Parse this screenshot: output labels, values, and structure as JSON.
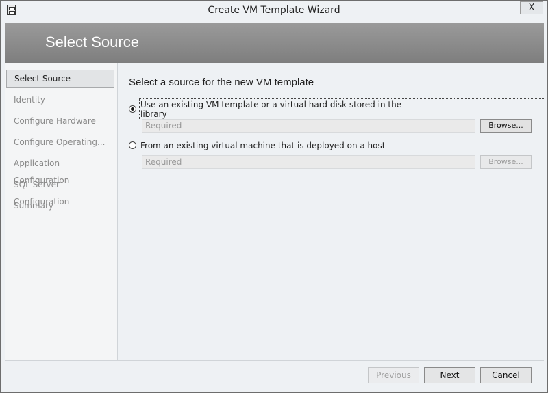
{
  "window": {
    "title": "Create VM Template Wizard",
    "close_glyph": "X",
    "app_icon": "server-icon"
  },
  "banner": {
    "title": "Select Source"
  },
  "nav": {
    "items": [
      {
        "label": "Select Source",
        "selected": true
      },
      {
        "label": "Identity",
        "selected": false
      },
      {
        "label": "Configure Hardware",
        "selected": false
      },
      {
        "label": "Configure Operating...",
        "selected": false
      },
      {
        "label": "Application Configuration",
        "selected": false
      },
      {
        "label": "SQL Server Configuration",
        "selected": false
      },
      {
        "label": "Summary",
        "selected": false
      }
    ]
  },
  "main": {
    "heading": "Select a source for the new VM template",
    "options": [
      {
        "label": "Use an existing VM template or a virtual hard disk stored in the library",
        "checked": true,
        "field_placeholder": "Required",
        "browse_label": "Browse...",
        "browse_enabled": true
      },
      {
        "label": "From an existing virtual machine that is deployed on a host",
        "checked": false,
        "field_placeholder": "Required",
        "browse_label": "Browse...",
        "browse_enabled": false
      }
    ]
  },
  "footer": {
    "previous_label": "Previous",
    "next_label": "Next",
    "cancel_label": "Cancel"
  }
}
